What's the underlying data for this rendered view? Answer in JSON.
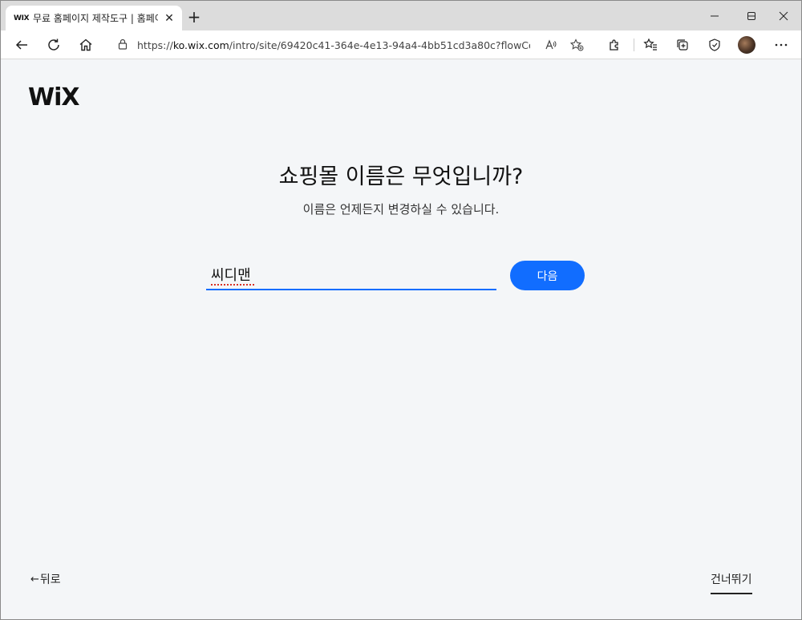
{
  "browser": {
    "tab": {
      "favicon": "WIX",
      "title": "무료 홈페이지 제작도구 | 홈페이지",
      "close_icon": "close-icon"
    },
    "new_tab_icon": "plus-icon",
    "window_controls": [
      "minimize-icon",
      "maximize-icon",
      "close-icon"
    ],
    "address": {
      "url_prefix": "https://",
      "url_host": "ko.wix.com",
      "url_rest": "/intro/site/69420c41-364e-4e13-94a4-4bb51cd3a80c?flowContext..."
    }
  },
  "page": {
    "logo": "WiX",
    "headline": "쇼핑몰 이름은 무엇입니까?",
    "subline": "이름은 언제든지 변경하실 수 있습니다.",
    "name_input": {
      "value": "씨디맨",
      "placeholder": ""
    },
    "next_button": "다음",
    "back_link": "뒤로",
    "skip_link": "건너뛰기"
  },
  "colors": {
    "accent": "#116dff",
    "page_bg": "#f4f6f8"
  }
}
